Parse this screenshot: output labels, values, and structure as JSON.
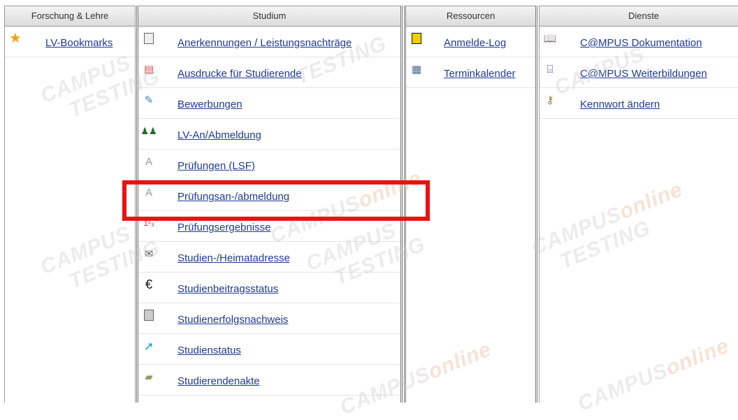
{
  "columns": [
    {
      "title": "Forschung & Lehre",
      "items": [
        {
          "label": "LV-Bookmarks",
          "icon": "star-icon"
        }
      ]
    },
    {
      "title": "Studium",
      "items": [
        {
          "label": "Anerkennungen / Leistungsnachträge",
          "icon": "document-icon"
        },
        {
          "label": "Ausdrucke für Studierende",
          "icon": "printer-icon"
        },
        {
          "label": "Bewerbungen",
          "icon": "edit-icon"
        },
        {
          "label": "LV-An/Abmeldung",
          "icon": "people-icon"
        },
        {
          "label": "Prüfungen (LSF)",
          "icon": "exam-icon"
        },
        {
          "label": "Prüfungsan-/abmeldung",
          "icon": "exam-icon"
        },
        {
          "label": "Prüfungsergebnisse",
          "icon": "grades-icon"
        },
        {
          "label": "Studien-/Heimatadresse",
          "icon": "envelope-icon"
        },
        {
          "label": "Studienbeitragsstatus",
          "icon": "euro-icon"
        },
        {
          "label": "Studienerfolgsnachweis",
          "icon": "certificate-icon"
        },
        {
          "label": "Studienstatus",
          "icon": "arrow-icon"
        },
        {
          "label": "Studierendenakte",
          "icon": "folder-icon"
        }
      ]
    },
    {
      "title": "Ressourcen",
      "items": [
        {
          "label": "Anmelde-Log",
          "icon": "lock-icon"
        },
        {
          "label": "Terminkalender",
          "icon": "calendar-icon"
        }
      ]
    },
    {
      "title": "Dienste",
      "items": [
        {
          "label": "C@MPUS Dokumentation",
          "icon": "book-icon"
        },
        {
          "label": "C@MPUS Weiterbildungen",
          "icon": "presentation-icon"
        },
        {
          "label": "Kennwort ändern",
          "icon": "key-icon"
        }
      ]
    }
  ],
  "watermark": {
    "text1": "CAMPUS",
    "text2": "online",
    "text3": "TESTING"
  },
  "colors": {
    "link": "#1f3a93",
    "highlight": "#ee1111"
  }
}
